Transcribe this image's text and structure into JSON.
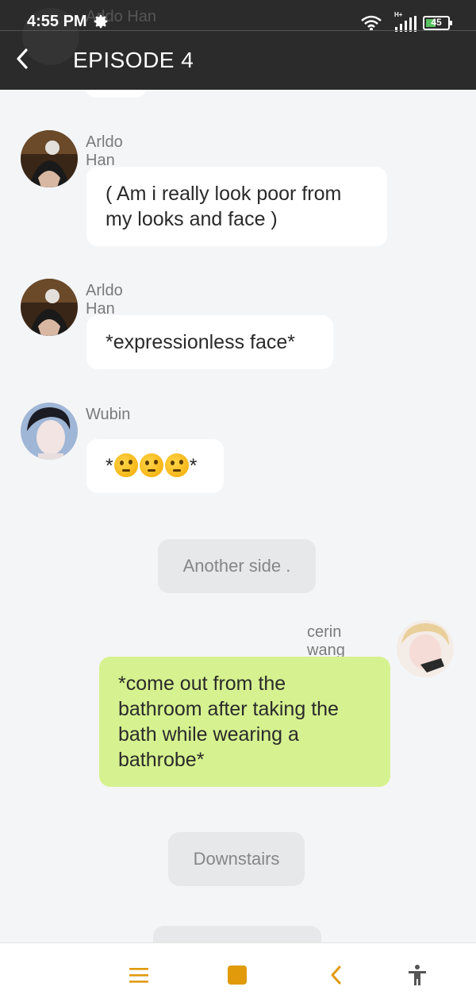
{
  "status_bar": {
    "time": "4:55 PM",
    "network_badge": "H+",
    "battery": "45",
    "ghost_name": "Arldo Han"
  },
  "header": {
    "title": "EPISODE 4",
    "back_icon": "chevron-left-icon"
  },
  "messages": [
    {
      "sender": "Arldo Han",
      "text": "( Am i really look poor from my looks and face )",
      "side": "left"
    },
    {
      "sender": "Arldo Han",
      "text": "*expressionless face*",
      "side": "left"
    },
    {
      "sender": "Wubin",
      "text_prefix": "*",
      "text_suffix": "*",
      "emojis": [
        "thinking-face",
        "thinking-face",
        "thinking-face"
      ],
      "side": "left"
    },
    {
      "type": "narration",
      "text": "Another side ."
    },
    {
      "sender": "cerin wang",
      "text": "*come out from the bathroom after taking the bath while wearing a bathrobe*",
      "side": "right"
    },
    {
      "type": "narration",
      "text": "Downstairs"
    }
  ],
  "bottom_bar": {
    "buttons": [
      "menu-icon",
      "stop-icon",
      "back-icon",
      "accessibility-icon"
    ],
    "accent": "#e09a0a"
  },
  "colors": {
    "appbar": "#2b2b2b",
    "bubble_self": "#d6f290",
    "bubble_other": "#ffffff",
    "narration": "#e7e8ea"
  }
}
